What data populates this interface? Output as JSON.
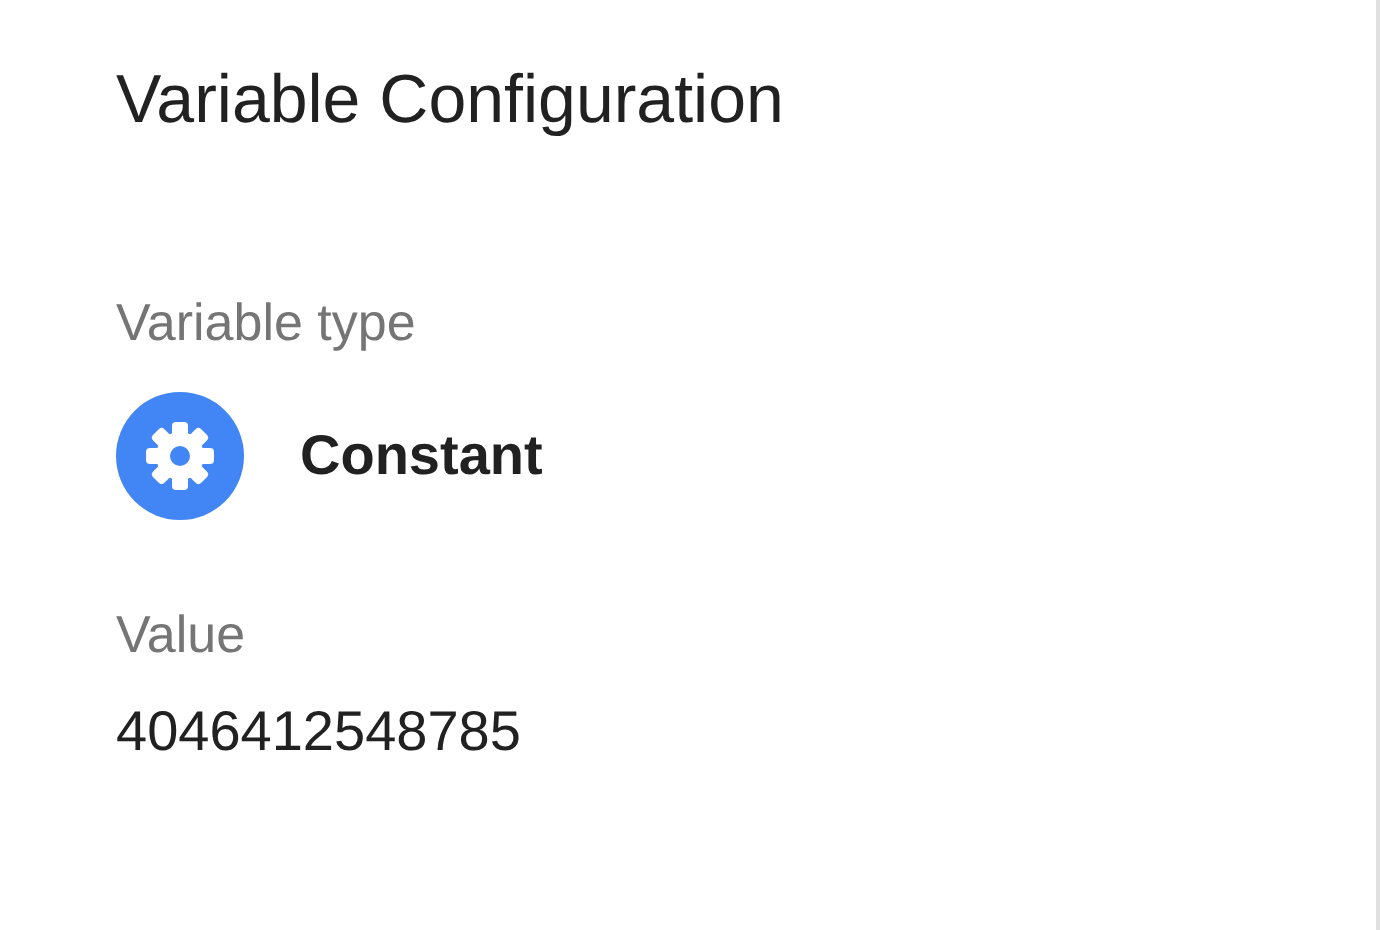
{
  "title": "Variable Configuration",
  "variable_type": {
    "label": "Variable type",
    "name": "Constant"
  },
  "value": {
    "label": "Value",
    "text": "4046412548785"
  }
}
